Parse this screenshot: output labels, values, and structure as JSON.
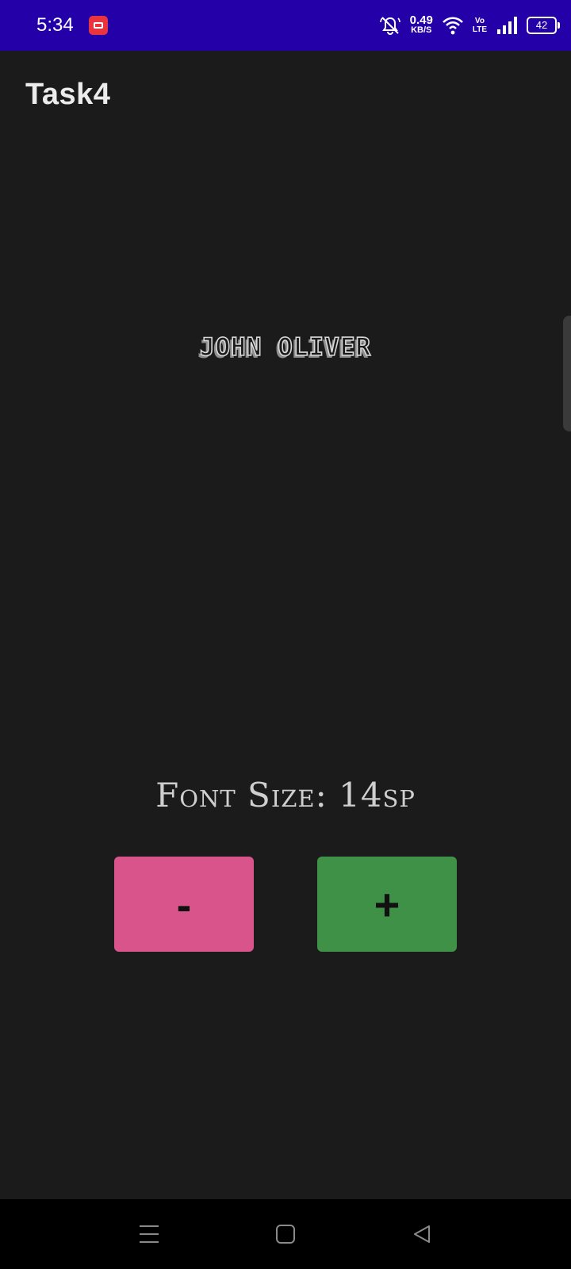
{
  "status_bar": {
    "time": "5:34",
    "net_speed_value": "0.49",
    "net_speed_unit": "KB/S",
    "volte_top": "Vo",
    "volte_bottom": "LTE",
    "battery_level": "42"
  },
  "app_bar": {
    "title": "Task4"
  },
  "main": {
    "name_text": "JOHN OLIVER",
    "font_size_label": "Font Size: 14sp"
  },
  "buttons": {
    "decrease_label": "-",
    "increase_label": "+"
  },
  "colors": {
    "status_bar": "#2400a8",
    "background": "#1b1b1b",
    "decrease_button": "#d9548a",
    "increase_button": "#3f9148"
  },
  "nav_bar": {
    "icons": [
      "menu-icon",
      "home-icon",
      "back-icon"
    ]
  }
}
